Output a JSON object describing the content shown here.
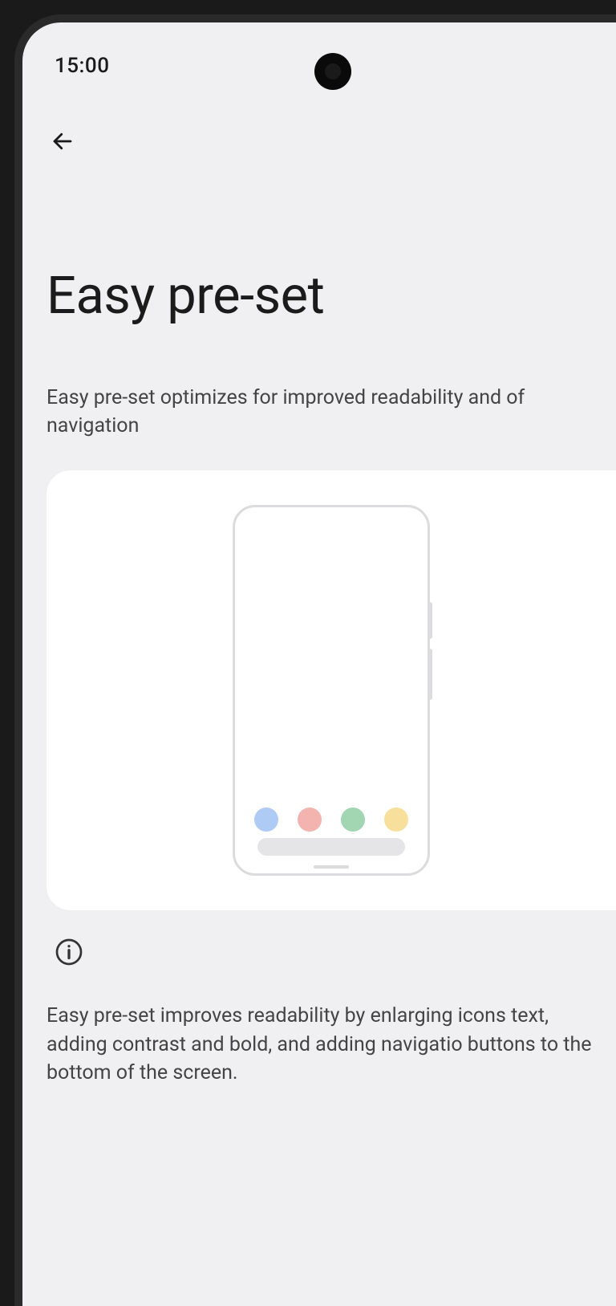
{
  "statusBar": {
    "time": "15:00"
  },
  "page": {
    "title": "Easy pre-set",
    "subtitle": "Easy pre-set optimizes for improved readability and of navigation"
  },
  "infoSection": {
    "text": "Easy pre-set improves readability by enlarging icons text, adding contrast and bold, and adding navigatio buttons to the bottom of the screen."
  },
  "previewIcons": {
    "colors": [
      "#aecbf5",
      "#f3b3ae",
      "#a2d5b2",
      "#f8df9b"
    ]
  }
}
